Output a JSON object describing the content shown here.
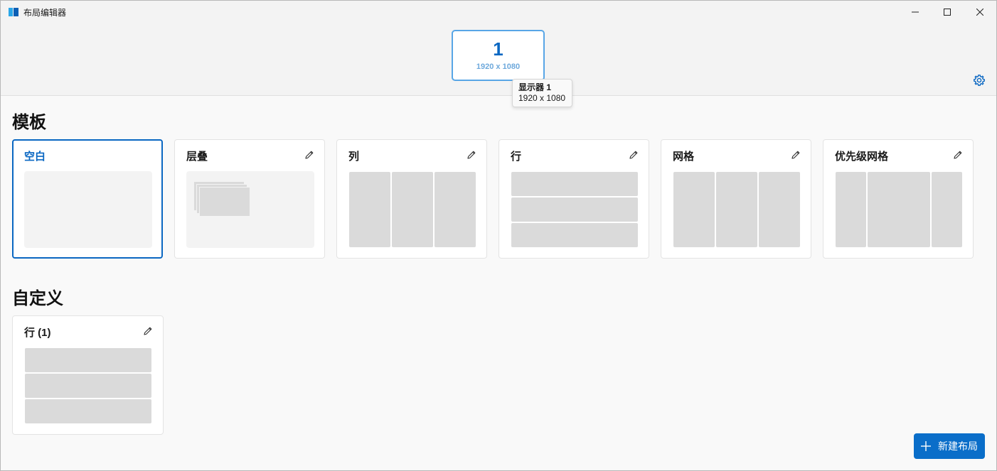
{
  "window": {
    "title": "布局编辑器"
  },
  "monitor": {
    "number": "1",
    "resolution": "1920 x 1080"
  },
  "tooltip": {
    "title": "显示器 1",
    "resolution": "1920 x 1080"
  },
  "sections": {
    "templates": "模板",
    "custom": "自定义"
  },
  "templates": [
    {
      "name": "空白",
      "selected": true,
      "editable": false
    },
    {
      "name": "层叠",
      "selected": false,
      "editable": true
    },
    {
      "name": "列",
      "selected": false,
      "editable": true
    },
    {
      "name": "行",
      "selected": false,
      "editable": true
    },
    {
      "name": "网格",
      "selected": false,
      "editable": true
    },
    {
      "name": "优先级网格",
      "selected": false,
      "editable": true
    }
  ],
  "custom": [
    {
      "name": "行 (1)",
      "editable": true
    }
  ],
  "new_layout_button": {
    "label": "新建布局"
  },
  "colors": {
    "accent": "#0a67c2",
    "zone": "#dadada",
    "button": "#0a6ec9"
  },
  "icons": {
    "app": "fancyzones-icon",
    "edit": "pencil-icon",
    "settings": "gear-icon",
    "add": "plus-icon"
  }
}
